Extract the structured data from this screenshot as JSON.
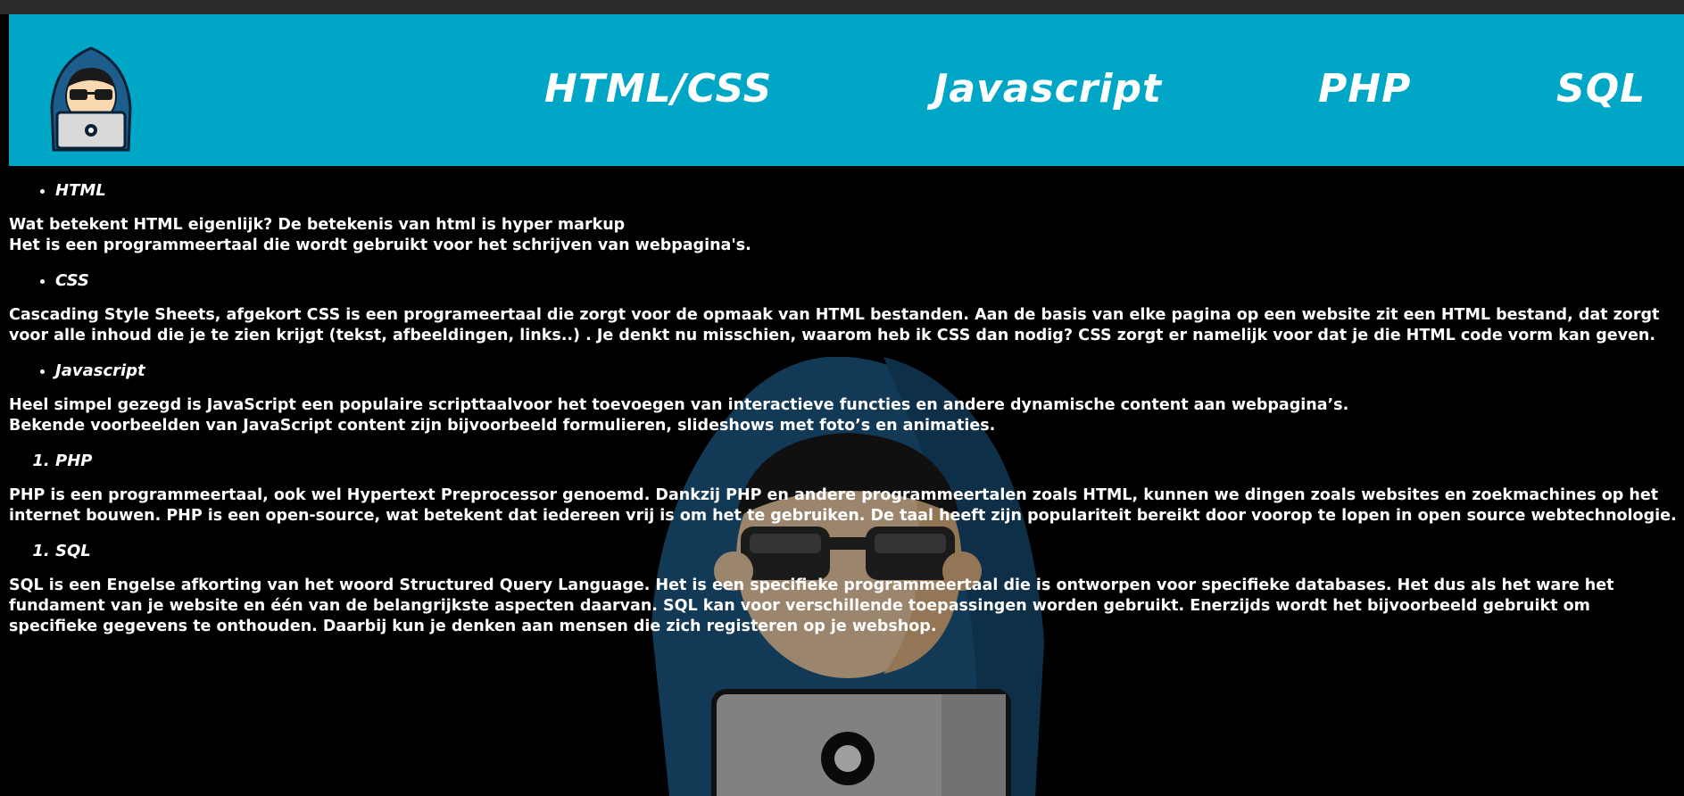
{
  "nav": {
    "items": [
      {
        "label": "HTML/CSS"
      },
      {
        "label": "Javascript"
      },
      {
        "label": "PHP"
      },
      {
        "label": "SQL"
      }
    ]
  },
  "sections": {
    "html": {
      "heading": "HTML",
      "line1": "Wat betekent HTML eigenlijk? De betekenis van html is hyper markup",
      "line2": "Het is een programmeertaal die wordt gebruikt voor het schrijven van webpagina's."
    },
    "css": {
      "heading": "CSS",
      "text": "Cascading Style Sheets, afgekort CSS is een programeertaal die zorgt voor de opmaak van HTML bestanden. Aan de basis van elke pagina op een website zit een HTML bestand, dat zorgt voor alle inhoud die je te zien krijgt (tekst, afbeeldingen, links..) . Je denkt nu misschien, waarom heb ik CSS dan nodig? CSS zorgt er namelijk voor dat je die HTML code vorm kan geven."
    },
    "javascript": {
      "heading": "Javascript",
      "line1": "Heel simpel gezegd is JavaScript een populaire scripttaalvoor het toevoegen van interactieve functies en andere dynamische content aan webpagina’s.",
      "line2": "Bekende voorbeelden van JavaScript content zijn bijvoorbeeld formulieren, slideshows met foto’s en animaties."
    },
    "php": {
      "heading": "PHP",
      "text": "PHP is een programmeertaal, ook wel Hypertext Preprocessor genoemd. Dankzij PHP en andere programmeertalen zoals HTML, kunnen we dingen zoals websites en zoekmachines op het internet bouwen. PHP is een open-source, wat betekent dat iedereen vrij is om het te gebruiken. De taal heeft zijn populariteit bereikt door voorop te lopen in open source webtechnologie."
    },
    "sql": {
      "heading": "SQL",
      "text": "SQL is een Engelse afkorting van het woord Structured Query Language. Het is een specifieke programmeertaal die is ontworpen voor specifieke databases. Het dus als het ware het fundament van je website en één van de belangrijkste aspecten daarvan. SQL kan voor verschillende toepassingen worden gebruikt. Enerzijds wordt het bijvoorbeeld gebruikt om specifieke gegevens te onthouden. Daarbij kun je denken aan mensen die zich registeren op je webshop."
    }
  },
  "colors": {
    "header_bg": "#00a6c6",
    "page_bg": "#000000",
    "hood": "#1d5d8c",
    "skin": "#fbd9b0"
  },
  "icons": {
    "logo": "hacker-logo-icon",
    "background": "hacker-background-illustration"
  }
}
